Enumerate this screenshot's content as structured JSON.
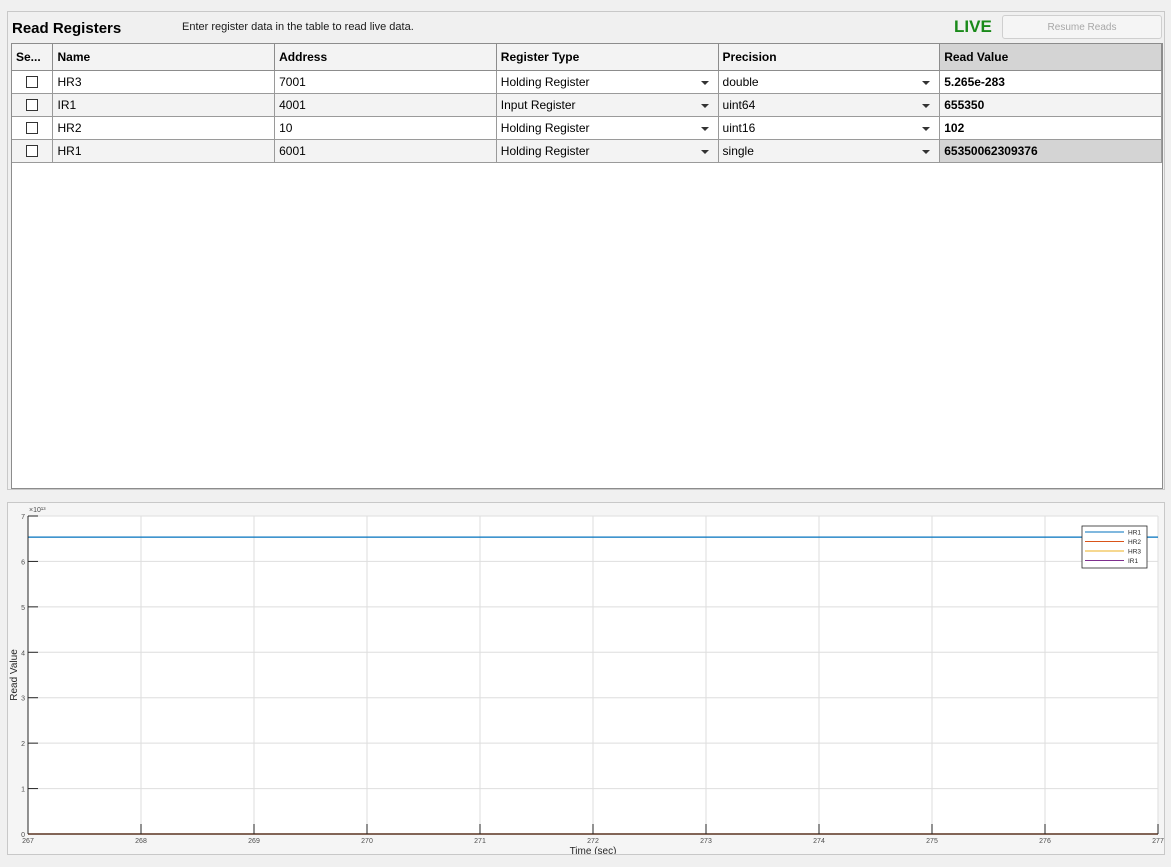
{
  "panel": {
    "title": "Read Registers",
    "instructions": "Enter register data in the table to read live data.",
    "live_label": "LIVE",
    "resume_label": "Resume Reads"
  },
  "table": {
    "headers": [
      "Se...",
      "Name",
      "Address",
      "Register Type",
      "Precision",
      "Read Value"
    ],
    "rows": [
      {
        "selected": false,
        "name": "HR3",
        "address": "7001",
        "register_type": "Holding Register",
        "precision": "double",
        "read_value": "5.265e-283"
      },
      {
        "selected": false,
        "name": "IR1",
        "address": "4001",
        "register_type": "Input Register",
        "precision": "uint64",
        "read_value": "655350"
      },
      {
        "selected": false,
        "name": "HR2",
        "address": "10",
        "register_type": "Holding Register",
        "precision": "uint16",
        "read_value": "102"
      },
      {
        "selected": false,
        "name": "HR1",
        "address": "6001",
        "register_type": "Holding Register",
        "precision": "single",
        "read_value": "65350062309376"
      }
    ]
  },
  "colors": {
    "live": "#1a8a1a",
    "HR1": "#0072bd",
    "HR2": "#d95319",
    "HR3": "#edb120",
    "IR1": "#7e2f8e"
  },
  "chart_data": {
    "type": "line",
    "xlabel": "Time (sec)",
    "ylabel": "Read Value",
    "exponent_label": "×10¹³",
    "xlim": [
      267,
      277
    ],
    "ylim": [
      0,
      7
    ],
    "xticks": [
      "267",
      "268",
      "269",
      "270",
      "271",
      "272",
      "273",
      "274",
      "275",
      "276",
      "277"
    ],
    "yticks": [
      "0",
      "1",
      "2",
      "3",
      "4",
      "5",
      "6",
      "7"
    ],
    "grid": true,
    "legend_position": "top-right",
    "series": [
      {
        "name": "HR1",
        "x": [
          267,
          277
        ],
        "y": [
          6.535,
          6.535
        ]
      },
      {
        "name": "HR2",
        "x": [
          267,
          277
        ],
        "y": [
          0,
          0
        ]
      },
      {
        "name": "HR3",
        "x": [
          267,
          277
        ],
        "y": [
          0,
          0
        ]
      },
      {
        "name": "IR1",
        "x": [
          267,
          277
        ],
        "y": [
          0,
          0
        ]
      }
    ]
  }
}
